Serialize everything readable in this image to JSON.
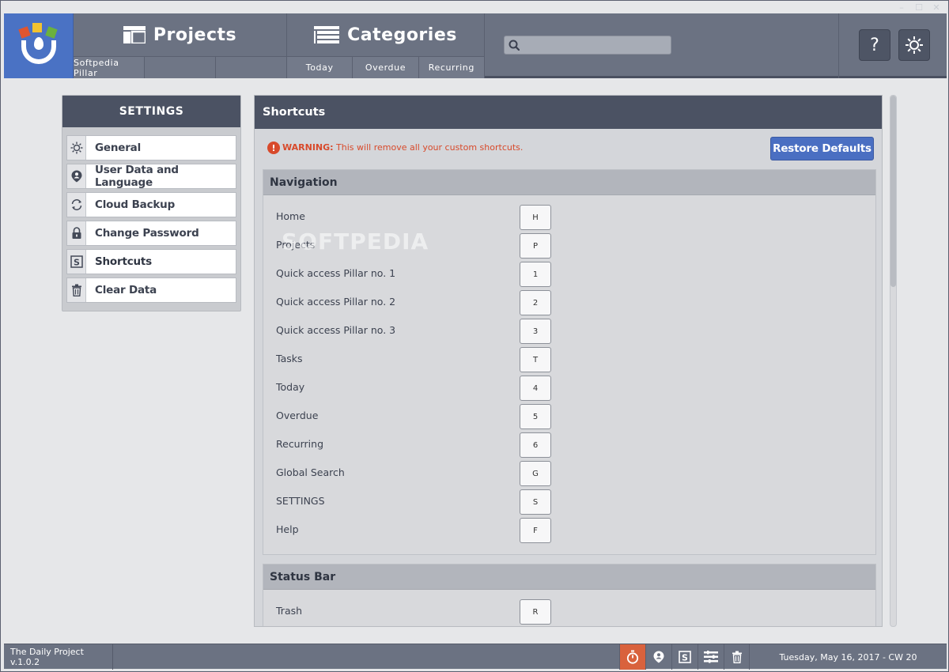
{
  "window": {
    "controls": [
      "–",
      "☐",
      "✕"
    ]
  },
  "header": {
    "projects": {
      "title": "Projects",
      "subs": [
        "Softpedia Pillar",
        "",
        ""
      ]
    },
    "categories": {
      "title": "Categories",
      "subs": [
        "Today",
        "Overdue",
        "Recurring"
      ]
    },
    "search": {
      "value": "",
      "placeholder": ""
    },
    "help_label": "?"
  },
  "settings": {
    "title": "SETTINGS",
    "items": [
      {
        "label": "General",
        "icon": "sun-icon"
      },
      {
        "label": "User Data and Language",
        "icon": "user-pin-icon"
      },
      {
        "label": "Cloud Backup",
        "icon": "sync-icon"
      },
      {
        "label": "Change Password",
        "icon": "lock-icon"
      },
      {
        "label": "Shortcuts",
        "icon": "shortcut-s-icon"
      },
      {
        "label": "Clear Data",
        "icon": "trash-icon"
      }
    ]
  },
  "main": {
    "title": "Shortcuts",
    "warning_prefix": "WARNING:",
    "warning_text": " This will remove all your custom shortcuts.",
    "restore_label": "Restore Defaults",
    "navigation": {
      "title": "Navigation",
      "rows": [
        {
          "label": "Home",
          "key": "H"
        },
        {
          "label": "Projects",
          "key": "P"
        },
        {
          "label": "Quick access Pillar no. 1",
          "key": "1"
        },
        {
          "label": "Quick access Pillar no. 2",
          "key": "2"
        },
        {
          "label": "Quick access Pillar no. 3",
          "key": "3"
        },
        {
          "label": "Tasks",
          "key": "T"
        },
        {
          "label": "Today",
          "key": "4"
        },
        {
          "label": "Overdue",
          "key": "5"
        },
        {
          "label": "Recurring",
          "key": "6"
        },
        {
          "label": "Global Search",
          "key": "G"
        },
        {
          "label": "SETTINGS",
          "key": "S"
        },
        {
          "label": "Help",
          "key": "F"
        }
      ]
    },
    "status_bar": {
      "title": "Status Bar",
      "rows": [
        {
          "label": "Trash",
          "key": "R"
        }
      ]
    }
  },
  "watermark": "SOFTPEDIA",
  "statusbar": {
    "version": "The Daily Project v.1.0.2",
    "date": "Tuesday, May 16, 2017 - CW 20",
    "icons": [
      "stopwatch-icon",
      "user-pin-icon",
      "shortcut-s-icon",
      "list-settings-icon",
      "trash-icon"
    ]
  },
  "colors": {
    "accent": "#4a72c4",
    "header": "#6b7282",
    "panel_head": "#4b5263",
    "warning": "#d84a2b",
    "status_active": "#d9623d"
  }
}
